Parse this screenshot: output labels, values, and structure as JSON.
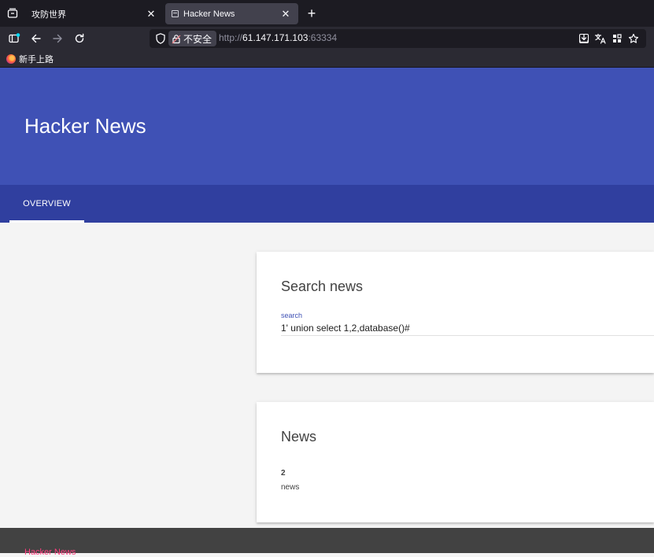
{
  "browser": {
    "tabs": [
      {
        "title": "攻防世界",
        "active": false
      },
      {
        "title": "Hacker News",
        "active": true
      }
    ],
    "url": {
      "security_label": "不安全",
      "scheme": "http://",
      "host": "61.147.171.103",
      "port": ":63334"
    },
    "bookmarks": [
      {
        "label": "新手上路"
      }
    ],
    "icons": {
      "tab_list": "tab-list-icon",
      "back": "back-arrow-icon",
      "forward": "forward-arrow-icon",
      "reload": "reload-icon",
      "sidebar": "sidebar-icon",
      "shield": "shield-icon",
      "lock_warning": "insecure-lock-icon",
      "download": "download-icon",
      "translate": "translate-icon",
      "extensions": "extensions-icon",
      "bookmark_star": "star-icon",
      "new_tab": "plus-icon",
      "close": "close-icon"
    }
  },
  "page": {
    "header": {
      "title": "Hacker News"
    },
    "nav": {
      "tabs": [
        {
          "label": "OVERVIEW",
          "active": true
        }
      ]
    },
    "search_card": {
      "title": "Search news",
      "field_label": "search",
      "field_value": "1' union select 1,2,database()#"
    },
    "news_card": {
      "title": "News",
      "items": [
        {
          "id": "2",
          "text": "news"
        }
      ]
    },
    "footer": {
      "brand": "Hacker News"
    }
  },
  "colors": {
    "primary": "#3f51b5",
    "primary_dark": "#303f9f",
    "accent": "#ff4081",
    "footer": "#424242"
  }
}
